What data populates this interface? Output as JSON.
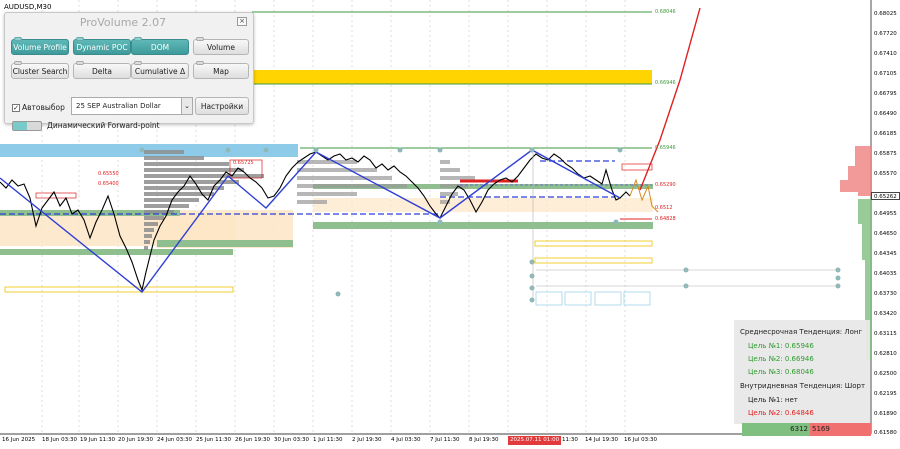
{
  "symbol": "AUDUSD,M30",
  "panel": {
    "title": "ProVolume 2.07",
    "close": "×",
    "buttons": {
      "volume_profile": "Volume Profile",
      "dynamic_poc": "Dynamic POC",
      "dom": "DOM",
      "volume": "Volume",
      "cluster_search": "Cluster Search",
      "delta": "Delta",
      "cumulative_delta": "Cumulative Δ",
      "map": "Map",
      "settings": "Настройки"
    },
    "auto_select_label": "Автовыбор",
    "auto_select_checked": true,
    "instrument_value": "25 SEP Australian Dollar",
    "forward_point_label": "Динамический Forward-point"
  },
  "levels": {
    "l1": "0.68046",
    "l2": "0.66946",
    "l3": "0.65946",
    "l4": "0.65550",
    "l5": "0.65400",
    "l6": "0.65725",
    "l7": "0.65290",
    "l8": "0.64828",
    "l9": "0.6512"
  },
  "price_axis": [
    "0.68025",
    "0.67720",
    "0.67410",
    "0.67105",
    "0.66795",
    "0.66490",
    "0.66185",
    "0.65875",
    "0.65570",
    "0.65262",
    "0.64955",
    "0.64650",
    "0.64345",
    "0.64035",
    "0.63730",
    "0.63420",
    "0.63115",
    "0.62810",
    "0.62500",
    "0.62195",
    "0.61890",
    "0.61580"
  ],
  "current_price": "0.65262",
  "time_axis": [
    "16 Jun 2025",
    "18 Jun 03:30",
    "19 Jun 11:30",
    "20 Jun 19:30",
    "24 Jun 03:30",
    "25 Jun 11:30",
    "26 Jun 19:30",
    "30 Jun 03:30",
    "1 Jul 11:30",
    "2 Jul 19:30",
    "4 Jul 03:30",
    "7 Jul 11:30",
    "8 Jul 19:30",
    "2025.07.11 01:00",
    "11:30",
    "14 Jul 19:30",
    "16 Jul 03:30"
  ],
  "trend": {
    "medium_title": "Среднесрочная Тенденция: Лонг",
    "m1": "Цель №1: 0.65946",
    "m2": "Цель №2: 0.66946",
    "m3": "Цель №3: 0.68046",
    "intraday_title": "Внутридневная Тенденция: Шорт",
    "i1": "Цель №1: нет",
    "i2": "Цель №2: 0.64846"
  },
  "volume_bar": {
    "buy": "6312",
    "sell": "5169"
  },
  "colors": {
    "accent_teal": "#4aa6a6",
    "zone_yellow": "#ffd400",
    "zone_blue": "#7fc6e8",
    "zone_green": "#8fbf8f",
    "zone_peach": "#fbe3c0",
    "trend_blue": "#2f3fd6",
    "target_red": "#e02020",
    "green_text": "#2e9b2e",
    "red_text": "#e02020"
  }
}
